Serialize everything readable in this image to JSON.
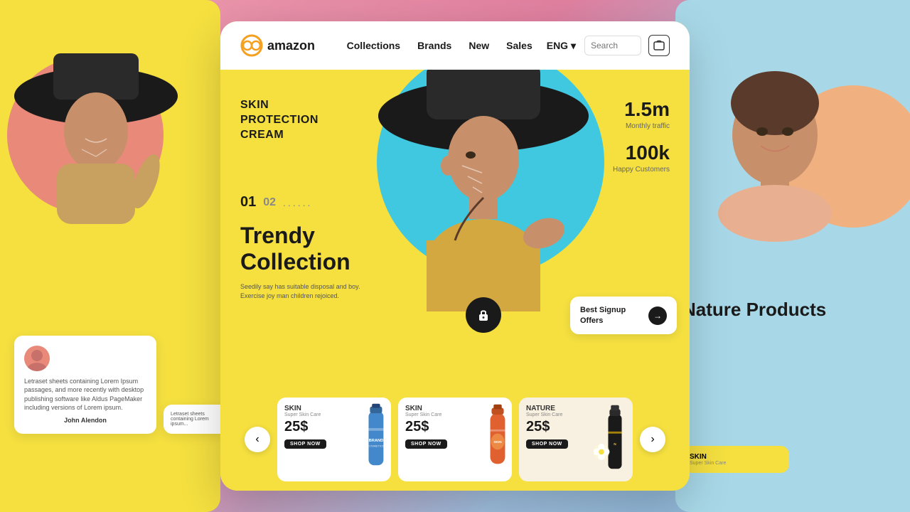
{
  "background": {
    "left_color": "#f5e040",
    "right_color": "#a8d8e8"
  },
  "navbar": {
    "logo_text": "amazon",
    "links": [
      "Collections",
      "Brands",
      "New",
      "Sales"
    ],
    "lang": "ENG ▾",
    "search_placeholder": "Search",
    "cart_label": "cart"
  },
  "hero": {
    "title_line1": "SKIN",
    "title_line2": "PROTECTION",
    "title_line3": "CREAM",
    "slide_current": "01",
    "slide_next": "02",
    "slide_dots": "......",
    "collection_heading_line1": "Trendy",
    "collection_heading_line2": "Collection",
    "description": "Seedily say has suitable disposal and boy.\nExercise joy man children rejoiced.",
    "stat1_number": "1.5m",
    "stat1_label": "Monthly traffic",
    "stat2_number": "100k",
    "stat2_label": "Happy Customers",
    "signup_text": "Best Signup\nOffers",
    "signup_arrow": "→"
  },
  "products": [
    {
      "category": "SKIN",
      "sub": "Super Skin Care",
      "price": "25$",
      "shop_label": "SHOP NOW",
      "color": "blue"
    },
    {
      "category": "SKIN",
      "sub": "Super Skin Care",
      "price": "25$",
      "shop_label": "SHOP NOW",
      "color": "orange"
    },
    {
      "category": "NATURE",
      "sub": "Super Skin Care",
      "price": "25$",
      "shop_label": "SHOP NOW",
      "color": "dark"
    }
  ],
  "testimonial": {
    "text": "Letraset sheets containing Lorem Ipsum passages, and more recently with desktop publishing software like Aldus PageMaker including versions of Lorem ipsum.",
    "name": "John Alendon"
  },
  "right_panel": {
    "heading": "Nature Products",
    "product_label": "SKIN"
  },
  "icons": {
    "prev": "‹",
    "next": "›",
    "cart": "☷",
    "lock": "🔒",
    "arrow_right": "→"
  }
}
